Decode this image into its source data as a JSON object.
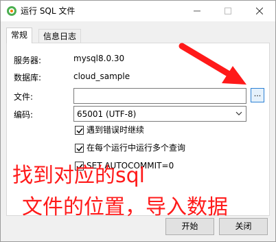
{
  "window": {
    "title": "运行 SQL 文件"
  },
  "tabs": [
    {
      "label": "常规"
    },
    {
      "label": "信息日志"
    }
  ],
  "form": {
    "server_label": "服务器:",
    "server_value": "mysql8.0.30",
    "database_label": "数据库:",
    "database_value": "cloud_sample",
    "file_label": "文件:",
    "file_value": "",
    "browse_label": "...",
    "encoding_label": "编码:",
    "encoding_value": "65001 (UTF-8)"
  },
  "options": [
    {
      "label": "遇到错误时继续",
      "checked": true
    },
    {
      "label": "在每个运行中运行多个查询",
      "checked": true
    },
    {
      "label": "SET AUTOCOMMIT=0",
      "checked": true
    }
  ],
  "buttons": {
    "start": "开始",
    "close": "关闭"
  },
  "annotation": {
    "line1": "找到对应的sql",
    "line2": "文件的位置，导入数据",
    "color": "#ff1a1a"
  },
  "colors": {
    "accent": "#2a7fd4"
  }
}
